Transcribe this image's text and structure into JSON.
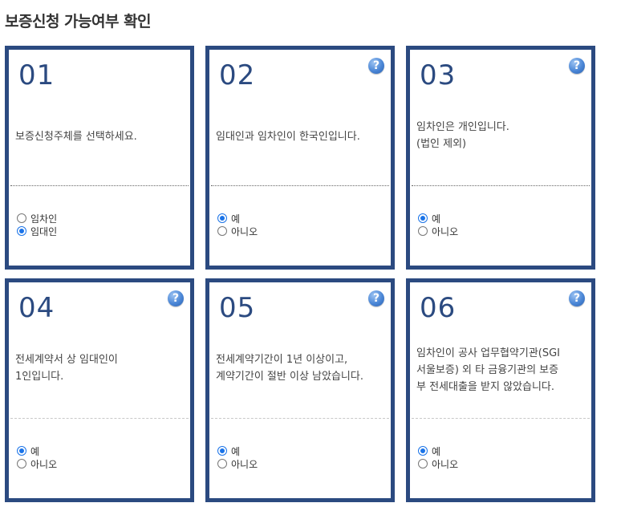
{
  "page_title": "보증신청 가능여부 확인",
  "cards": [
    {
      "number": "01",
      "has_help": false,
      "question": "보증신청주체를 선택하세요.",
      "options": [
        {
          "label": "임차인",
          "checked": false
        },
        {
          "label": "임대인",
          "checked": true
        }
      ]
    },
    {
      "number": "02",
      "has_help": true,
      "help_icon": "question-circle-icon",
      "question": "임대인과 임차인이 한국인입니다.",
      "options": [
        {
          "label": "예",
          "checked": true
        },
        {
          "label": "아니오",
          "checked": false
        }
      ]
    },
    {
      "number": "03",
      "has_help": true,
      "help_icon": "question-circle-icon",
      "question": "임차인은 개인입니다.\n(법인 제외)",
      "options": [
        {
          "label": "예",
          "checked": true
        },
        {
          "label": "아니오",
          "checked": false
        }
      ]
    },
    {
      "number": "04",
      "has_help": true,
      "help_icon": "question-circle-icon",
      "question": "전세계약서 상 임대인이\n1인입니다.",
      "options": [
        {
          "label": "예",
          "checked": true
        },
        {
          "label": "아니오",
          "checked": false
        }
      ]
    },
    {
      "number": "05",
      "has_help": true,
      "help_icon": "question-circle-icon",
      "question": "전세계약기간이 1년 이상이고,\n계약기간이 절반 이상 남았습니다.",
      "options": [
        {
          "label": "예",
          "checked": true
        },
        {
          "label": "아니오",
          "checked": false
        }
      ]
    },
    {
      "number": "06",
      "has_help": true,
      "help_icon": "question-circle-icon",
      "question": "임차인이 공사 업무협약기관(SGI\n서울보증) 외 타 금융기관의 보증\n부 전세대출을 받지 않았습니다.",
      "options": [
        {
          "label": "예",
          "checked": true
        },
        {
          "label": "아니오",
          "checked": false
        }
      ]
    }
  ],
  "help_symbol": "?",
  "colors": {
    "card_border": "#2b4a80",
    "number": "#2b4a80",
    "radio_checked": "#1a73e8",
    "help_icon": "#4a86d6"
  }
}
